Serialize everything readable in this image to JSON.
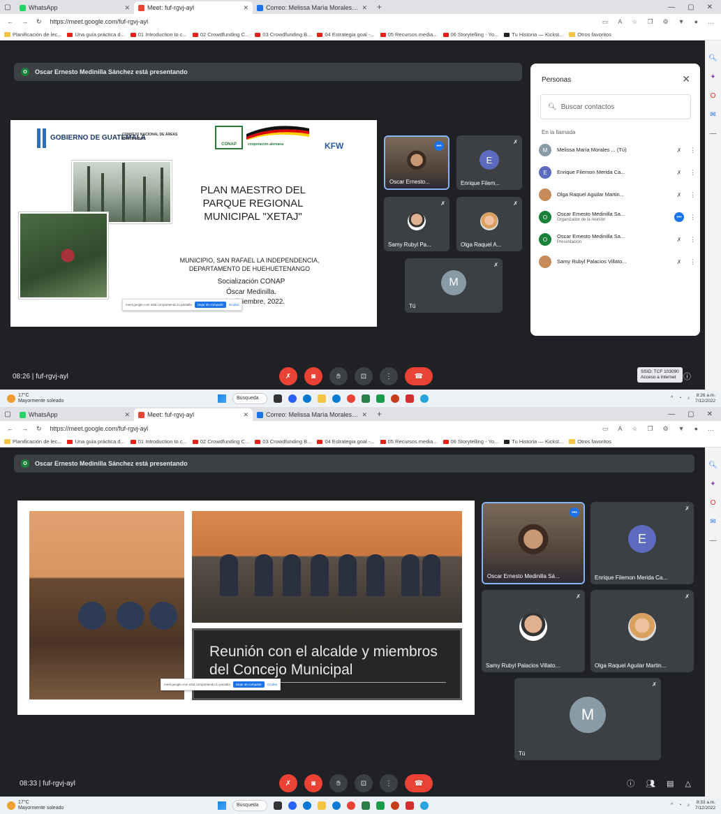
{
  "shared": {
    "tabs": [
      {
        "label": "WhatsApp",
        "color": "#25d366"
      },
      {
        "label": "Meet: fuf-rgvj-ayl",
        "color": "#ea4335"
      },
      {
        "label": "Correo: Melissa María Morales T...",
        "color": "#1a73e8"
      }
    ],
    "url": "https://meet.google.com/fuf-rgvj-ayl",
    "bookmarks_1": [
      "Planificación de lec...",
      "Una guía práctica d...",
      "01 Introduction to c...",
      "02 Crowdfunding C...",
      "03 Crowdfunding B...",
      "04 Estrategia goal -...",
      "05 Recursos media...",
      "06 Storytelling - Yo...",
      "Tu Historia — Kickst..."
    ],
    "bookmarks_1_more": "Otros favoritos",
    "presenting_text": "Oscar Ernesto Medinilla Sánchez está presentando",
    "meeting_code": "fuf-rgvj-ayl"
  },
  "shot1": {
    "time": "08:26",
    "slide": {
      "gt_logo": "GOBIERNO DE GUATEMALA",
      "conap_org": "CONSEJO NACIONAL DE ÁREAS PROTEGIDAS",
      "conap_logo": "CONAP",
      "coop": "cooperación alemana",
      "kfw": "KFW",
      "title": "PLAN MAESTRO DEL PARQUE REGIONAL MUNICIPAL \"XETAJ\"",
      "subtitle": "MUNICIPIO, SAN RAFAEL LA INDEPENDENCIA, DEPARTAMENTO DE HUEHUETENANGO",
      "line1": "Socialización CONAP",
      "line2": "Óscar Medinilla.",
      "line3": "7 de diciembre, 2022."
    },
    "share_toast": {
      "text": "meet.google.com está compartiendo tu pantalla",
      "stop": "Dejar de compartir",
      "hide": "Ocultar"
    },
    "tiles": [
      {
        "name": "Oscar Ernesto...",
        "letter": ""
      },
      {
        "name": "Enrique Filem...",
        "letter": "E"
      },
      {
        "name": "Samy Rubyl Pa...",
        "letter": ""
      },
      {
        "name": "Olga Raquel A...",
        "letter": ""
      },
      {
        "name": "Tú",
        "letter": "M"
      }
    ],
    "people": {
      "title": "Personas",
      "search_placeholder": "Buscar contactos",
      "section": "En la llamada",
      "list": [
        {
          "name": "Melissa María Morales ... (Tú)",
          "role": "",
          "letter": "M",
          "color": "#8a9ba8"
        },
        {
          "name": "Enrique Filemon Merida Ca...",
          "role": "",
          "letter": "E",
          "color": "#5c6bc0"
        },
        {
          "name": "Olga Raquel Aguilar Martin...",
          "role": "",
          "letter": "",
          "color": "#c68b59"
        },
        {
          "name": "Oscar Ernesto Medinilla Sa...",
          "role": "Organizador de la reunión",
          "letter": "O",
          "color": "#188038"
        },
        {
          "name": "Oscar Ernesto Medinilla Sa...",
          "role": "Presentación",
          "letter": "O",
          "color": "#188038"
        },
        {
          "name": "Samy Rubyl Palacios Villato...",
          "role": "",
          "letter": "",
          "color": "#c68b59"
        }
      ]
    },
    "tooltip": {
      "line1": "SSID: TCF 103090",
      "line2": "Acceso a Internet"
    }
  },
  "shot2": {
    "time": "08:33",
    "slide_title": "Reunión con el alcalde y miembros del Concejo Municipal",
    "share_toast": {
      "text": "meet.google.com está compartiendo tu pantalla",
      "stop": "Dejar de compartir",
      "hide": "Ocultar"
    },
    "tiles": [
      {
        "name": "Oscar Ernesto Medinilla Sá...",
        "letter": ""
      },
      {
        "name": "Enrique Filemon Merida Ca...",
        "letter": "E"
      },
      {
        "name": "Samy Rubyl Palacios Villato...",
        "letter": ""
      },
      {
        "name": "Olga Raquel Aguilar Martin...",
        "letter": ""
      },
      {
        "name": "Tú",
        "letter": "M"
      }
    ]
  },
  "taskbar": {
    "temp": "17°C",
    "weather": "Mayormente soleado",
    "search": "Búsqueda",
    "clock1_time": "8:26 a.m.",
    "clock2_time": "8:33 a.m.",
    "date": "7/12/2022"
  },
  "colors": {
    "meet_bg": "#202124",
    "tile_bg": "#3c4043",
    "red": "#ea4335",
    "blue": "#1a73e8",
    "green": "#188038"
  }
}
